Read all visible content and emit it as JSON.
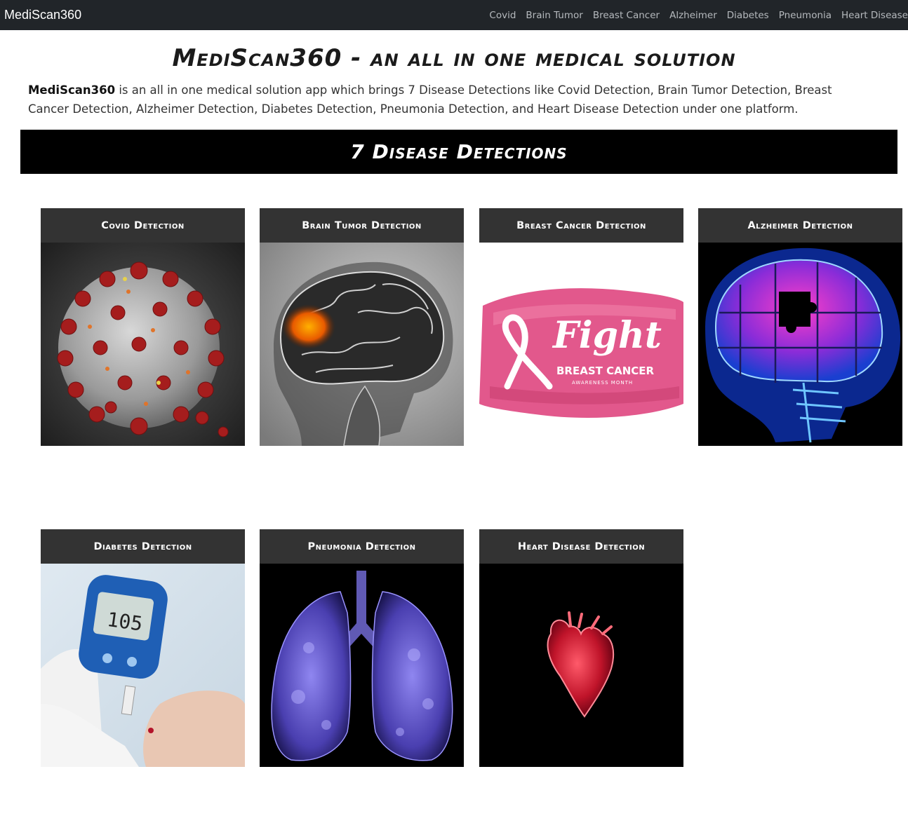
{
  "navbar": {
    "brand": "MediScan360",
    "links": [
      "Covid",
      "Brain Tumor",
      "Breast Cancer",
      "Alzheimer",
      "Diabetes",
      "Pneumonia",
      "Heart Disease"
    ]
  },
  "header": {
    "title": "MediScan360 - an all in one medical solution",
    "intro_brand": "MediScan360",
    "intro_text": " is an all in one medical solution app which brings 7 Disease Detections like Covid Detection, Brain Tumor Detection, Breast Cancer Detection, Alzheimer Detection, Diabetes Detection, Pneumonia Detection, and Heart Disease Detection under one platform."
  },
  "section": {
    "title": "7 Disease Detections"
  },
  "cards": [
    {
      "title": "Covid Detection",
      "image": "coronavirus-illustration"
    },
    {
      "title": "Brain Tumor Detection",
      "image": "brain-xray-illustration"
    },
    {
      "title": "Breast Cancer Detection",
      "image": "pink-ribbon-illustration",
      "image_text": "Fight",
      "image_subtext": "BREAST CANCER",
      "image_caption": "AWARENESS MONTH"
    },
    {
      "title": "Alzheimer Detection",
      "image": "brain-puzzle-illustration"
    },
    {
      "title": "Diabetes Detection",
      "image": "glucose-meter-illustration",
      "image_text": "105"
    },
    {
      "title": "Pneumonia Detection",
      "image": "lungs-xray-illustration"
    },
    {
      "title": "Heart Disease Detection",
      "image": "heart-illustration"
    }
  ]
}
